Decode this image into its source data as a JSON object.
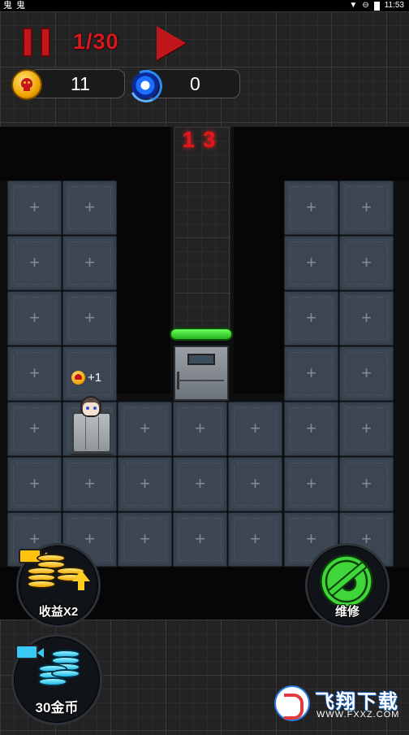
{
  "status_bar": {
    "left_icons": "鬼 鬼",
    "time": "11:53"
  },
  "hud": {
    "wave": "1/30",
    "skull_coins": "11",
    "portal_energy": "0"
  },
  "room_counter": "13",
  "bonus_popup": "+1",
  "buttons": {
    "income_label": "收益X2",
    "coins_label": "30金币",
    "repair_label": "维修"
  },
  "watermark": {
    "title": "飞翔下载",
    "url": "WWW.FXXZ.COM"
  },
  "colors": {
    "accent_red": "#c0171c",
    "health_green": "#3fd63a",
    "coin_gold": "#f0a400",
    "tile": "#3c4552"
  },
  "icons": {
    "pause": "pause-icon",
    "play": "play-icon",
    "skull_coin": "skull-coin-icon",
    "portal": "portal-icon",
    "video": "video-camera-icon",
    "gear": "gear-wrench-icon"
  }
}
